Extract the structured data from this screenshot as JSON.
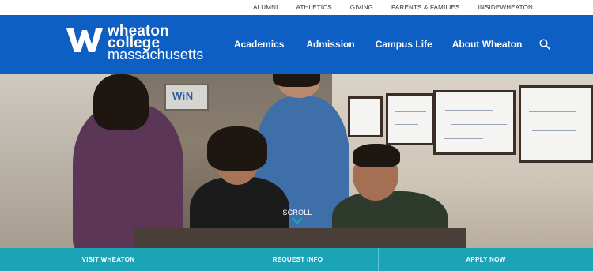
{
  "utility_nav": {
    "items": [
      "ALUMNI",
      "ATHLETICS",
      "GIVING",
      "PARENTS & FAMILIES",
      "INSIDEWHEATON"
    ]
  },
  "logo": {
    "line1": "wheaton",
    "line2": "college",
    "line3": "massachusetts"
  },
  "main_nav": {
    "items": [
      "Academics",
      "Admission",
      "Campus Life",
      "About Wheaton"
    ],
    "search_icon": "search-icon"
  },
  "hero": {
    "sign_text": "WiN",
    "scroll_label": "SCROLL",
    "scroll_icon": "chevron-down-icon"
  },
  "cta": {
    "items": [
      "VISIT WHEATON",
      "REQUEST INFO",
      "APPLY NOW"
    ]
  },
  "colors": {
    "header_blue": "#0d5fc4",
    "cta_teal": "#1aa4b5",
    "scroll_chevron": "#1aa4b5"
  }
}
